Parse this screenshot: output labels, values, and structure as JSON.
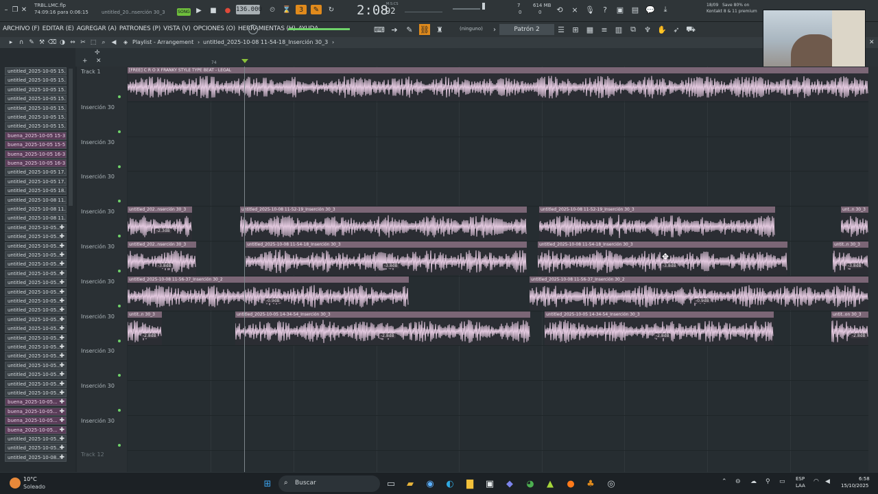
{
  "app": {
    "file_name": "TRBL.LMC.flp",
    "session_time": "74:09:16 para 0:06:15",
    "clip_short": "untitled_20..nserción 30_3",
    "song_mode": "SONG",
    "tempo": "136.000",
    "time": "2:08",
    "time_frac": "92",
    "time_unit": "M:S:CS",
    "cpu": "7",
    "memory": "614 MB",
    "memory_sub": "0",
    "poly": "0",
    "notice_date": "18/09",
    "notice_line1": "Save 80% on",
    "notice_line2": "Kontakt 8 & 11 premium"
  },
  "menu": {
    "items": [
      "ARCHIVO (F)",
      "EDITAR (E)",
      "AGREGAR (A)",
      "PATRONES (P)",
      "VISTA (V)",
      "OPCIONES (O)",
      "HERRAMIENTAS (H)",
      "AYUDA"
    ],
    "snap": "(ninguno)",
    "pattern": "Patrón 2"
  },
  "playlist_header": {
    "title": "Playlist - Arrangement",
    "clip_path": "untitled_2025-10-08 11-54-18_Inserción 30_3",
    "marker": "74"
  },
  "browser": {
    "items": [
      {
        "label": "untitled_2025-10-05 15...",
        "buena": false,
        "plus": false
      },
      {
        "label": "untitled_2025-10-05 15...",
        "buena": false,
        "plus": false
      },
      {
        "label": "untitled_2025-10-05 15...",
        "buena": false,
        "plus": false
      },
      {
        "label": "untitled_2025-10-05 15...",
        "buena": false,
        "plus": false
      },
      {
        "label": "untitled_2025-10-05 15...",
        "buena": false,
        "plus": false
      },
      {
        "label": "untitled_2025-10-05 15...",
        "buena": false,
        "plus": false
      },
      {
        "label": "untitled_2025-10-05 15...",
        "buena": false,
        "plus": false
      },
      {
        "label": "buena_2025-10-05 15-3...",
        "buena": true,
        "plus": false
      },
      {
        "label": "buena_2025-10-05 15-5...",
        "buena": true,
        "plus": false
      },
      {
        "label": "buena_2025-10-05 16-3...",
        "buena": true,
        "plus": false
      },
      {
        "label": "buena_2025-10-05 16-3...",
        "buena": true,
        "plus": false
      },
      {
        "label": "untitled_2025-10-05 17...",
        "buena": false,
        "plus": false
      },
      {
        "label": "untitled_2025-10-05 17...",
        "buena": false,
        "plus": false
      },
      {
        "label": "untitled_2025-10-05 18...",
        "buena": false,
        "plus": false
      },
      {
        "label": "untitled_2025-10-08 11...",
        "buena": false,
        "plus": false
      },
      {
        "label": "untitled_2025-10-08 11...",
        "buena": false,
        "plus": false
      },
      {
        "label": "untitled_2025-10-08 11...",
        "buena": false,
        "plus": false
      },
      {
        "label": "untitled_2025-10-05...",
        "buena": false,
        "plus": true
      },
      {
        "label": "untitled_2025-10-05...",
        "buena": false,
        "plus": true
      },
      {
        "label": "untitled_2025-10-05...",
        "buena": false,
        "plus": true
      },
      {
        "label": "untitled_2025-10-05...",
        "buena": false,
        "plus": true
      },
      {
        "label": "untitled_2025-10-05...",
        "buena": false,
        "plus": true
      },
      {
        "label": "untitled_2025-10-05...",
        "buena": false,
        "plus": true
      },
      {
        "label": "untitled_2025-10-05...",
        "buena": false,
        "plus": true
      },
      {
        "label": "untitled_2025-10-05...",
        "buena": false,
        "plus": true
      },
      {
        "label": "untitled_2025-10-05...",
        "buena": false,
        "plus": true
      },
      {
        "label": "untitled_2025-10-05...",
        "buena": false,
        "plus": true
      },
      {
        "label": "untitled_2025-10-05...",
        "buena": false,
        "plus": true
      },
      {
        "label": "untitled_2025-10-05...",
        "buena": false,
        "plus": true
      },
      {
        "label": "untitled_2025-10-05...",
        "buena": false,
        "plus": true
      },
      {
        "label": "untitled_2025-10-05...",
        "buena": false,
        "plus": true
      },
      {
        "label": "untitled_2025-10-05...",
        "buena": false,
        "plus": true
      },
      {
        "label": "untitled_2025-10-05...",
        "buena": false,
        "plus": true
      },
      {
        "label": "untitled_2025-10-05...",
        "buena": false,
        "plus": true
      },
      {
        "label": "untitled_2025-10-05...",
        "buena": false,
        "plus": true
      },
      {
        "label": "untitled_2025-10-05...",
        "buena": false,
        "plus": true
      },
      {
        "label": "buena_2025-10-05...",
        "buena": true,
        "plus": true
      },
      {
        "label": "buena_2025-10-05...",
        "buena": true,
        "plus": true
      },
      {
        "label": "buena_2025-10-05...",
        "buena": true,
        "plus": true
      },
      {
        "label": "buena_2025-10-05...",
        "buena": true,
        "plus": true
      },
      {
        "label": "untitled_2025-10-05...",
        "buena": false,
        "plus": true
      },
      {
        "label": "untitled_2025-10-05...",
        "buena": false,
        "plus": true
      },
      {
        "label": "untitled_2025-10-08...",
        "buena": false,
        "plus": true
      }
    ]
  },
  "tracks": [
    {
      "name": "Track 1"
    },
    {
      "name": "Inserción 30"
    },
    {
      "name": "Inserción 30"
    },
    {
      "name": "Inserción 30"
    },
    {
      "name": "Inserción 30"
    },
    {
      "name": "Inserción 30"
    },
    {
      "name": "Inserción 30"
    },
    {
      "name": "Inserción 30"
    },
    {
      "name": "Inserción 30"
    },
    {
      "name": "Inserción 30"
    },
    {
      "name": "Inserción 30"
    },
    {
      "name": "Track 12"
    }
  ],
  "clips": [
    {
      "row": 0,
      "label": "[FREE] C R O X FRANKY STYLE TYPE BEAT - LEGAL",
      "gain": ""
    },
    {
      "row": 4,
      "label": "untitled_202..nserción 30_3",
      "gain": "-2.3dB"
    },
    {
      "row": 4,
      "label": "untitled_2025-10-08 11-52-19_Inserción 30_3",
      "gain": ""
    },
    {
      "row": 4,
      "label": "untitled_2025-10-08 11-52-19_Inserción 30_3",
      "gain": ""
    },
    {
      "row": 4,
      "label": "unt..n 30_3",
      "gain": ""
    },
    {
      "row": 5,
      "label": "untitled_202..nserción 30_3",
      "gain": "-3.8dB"
    },
    {
      "row": 5,
      "label": "untitled_2025-10-08 11-54-18_Inserción 30_3",
      "gain": "-3.8dB"
    },
    {
      "row": 5,
      "label": "untitled_2025-10-08 11-54-18_Inserción 30_3",
      "gain": "-3.8dB"
    },
    {
      "row": 5,
      "label": "untit..n 30_3",
      "gain": "-3.8dB"
    },
    {
      "row": 6,
      "label": "untitled_2025-10-08 11-56-37_Inserción 30_2",
      "gain": "-0.9dB"
    },
    {
      "row": 6,
      "label": "untitled_2025-10-08 11-56-37_Inserción 30_2",
      "gain": "-0.9dB"
    },
    {
      "row": 7,
      "label": "untit..n 30_3",
      "gain": "-2.8dB"
    },
    {
      "row": 7,
      "label": "untitled_2025-10-05 14-34-54_Inserción 30_3",
      "gain": "-2.8dB"
    },
    {
      "row": 7,
      "label": "untitled_2025-10-05 14-34-54_Inserción 30_3",
      "gain": "-2.8dB"
    },
    {
      "row": 7,
      "label": "untit..on 30_3",
      "gain": "-2.8dB"
    }
  ],
  "taskbar": {
    "temperature": "10°C",
    "weather": "Soleado",
    "search": "Buscar",
    "lang": "ESP",
    "lang_sub": "LAA",
    "clock": "6:58",
    "date": "15/10/2025"
  },
  "colors": {
    "clip_header": "#7b6676",
    "waveform": "#e3c9df",
    "accent_orange": "#e08a1c",
    "green_led": "#6fd36a"
  }
}
